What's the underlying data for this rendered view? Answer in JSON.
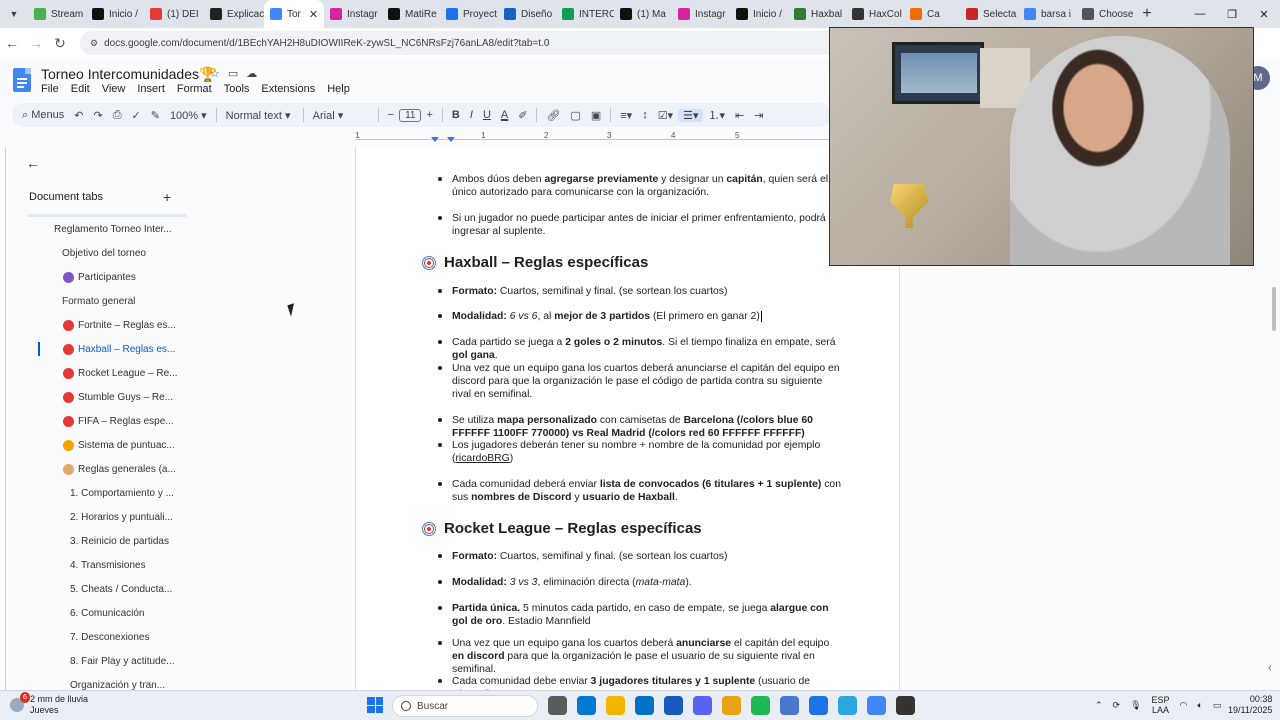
{
  "browser": {
    "tabs": [
      {
        "label": "Stream",
        "color": "#4caf50",
        "icon": "stream-icon"
      },
      {
        "label": "Inicio /",
        "color": "#111111",
        "icon": "x-icon"
      },
      {
        "label": "(1) DEI",
        "color": "#e53935",
        "icon": "youtube-icon"
      },
      {
        "label": "Explicac",
        "color": "#222222",
        "icon": "chatgpt-icon"
      },
      {
        "label": "Tor",
        "color": "#4285f4",
        "icon": "docs-icon",
        "active": true
      },
      {
        "label": "Instagr",
        "color": "#d6249f",
        "icon": "instagram-icon"
      },
      {
        "label": "MatiRe",
        "color": "#111111",
        "icon": "x-icon"
      },
      {
        "label": "Proyect",
        "color": "#1a73e8",
        "icon": "globe-icon"
      },
      {
        "label": "Diseño",
        "color": "#1565c0",
        "icon": "globe-icon"
      },
      {
        "label": "INTERC",
        "color": "#0f9d58",
        "icon": "sheets-icon"
      },
      {
        "label": "(1) Ma",
        "color": "#111111",
        "icon": "x-icon"
      },
      {
        "label": "Instagr",
        "color": "#d6249f",
        "icon": "instagram-icon"
      },
      {
        "label": "Inicio /",
        "color": "#111111",
        "icon": "x-icon"
      },
      {
        "label": "Haxbal",
        "color": "#2e7d32",
        "icon": "haxball-icon"
      },
      {
        "label": "HaxCol",
        "color": "#333333",
        "icon": "haxcol-icon"
      },
      {
        "label": "Ca",
        "color": "#ef6c00",
        "icon": "brave-icon"
      },
      {
        "label": "Selecta",
        "color": "#c62828",
        "icon": "selecta-icon"
      },
      {
        "label": "barsa i",
        "color": "#4285f4",
        "icon": "google-icon"
      },
      {
        "label": "Choose",
        "color": "#555555",
        "icon": "globe-icon"
      }
    ],
    "close_glyph": "✕",
    "new_tab_glyph": "+",
    "window_controls": [
      "—",
      "❐",
      "✕"
    ],
    "url": "docs.google.com/document/d/1BEchYAH2H8uDIOWIIReK-zywSL_NC6NRsFzj76anLA8/edit?tab=t.0"
  },
  "doc": {
    "title": "Torneo Intercomunidades🏆",
    "menu": [
      "File",
      "Edit",
      "View",
      "Insert",
      "Format",
      "Tools",
      "Extensions",
      "Help"
    ],
    "avatar_initial": "M"
  },
  "toolbar": {
    "search_label": "Menus",
    "zoom": "100%",
    "style": "Normal text",
    "font": "Arial",
    "font_size": "11"
  },
  "ruler": {
    "numbers": [
      "1",
      "1",
      "2",
      "3",
      "4",
      "5"
    ]
  },
  "sidebar": {
    "title": "Document tabs",
    "add_glyph": "+",
    "back_glyph": "←",
    "items": [
      {
        "label": "Reglamento Torneo Inter...",
        "indent": 0,
        "emoji": ""
      },
      {
        "label": "Objetivo del torneo",
        "indent": 1,
        "emoji": ""
      },
      {
        "label": "Participantes",
        "indent": 1,
        "emoji": "people"
      },
      {
        "label": "Formato general",
        "indent": 1,
        "emoji": ""
      },
      {
        "label": "Fortnite – Reglas es...",
        "indent": 1,
        "emoji": "target"
      },
      {
        "label": "Haxball – Reglas es...",
        "indent": 1,
        "emoji": "target",
        "active": true
      },
      {
        "label": "Rocket League – Re...",
        "indent": 1,
        "emoji": "target"
      },
      {
        "label": "Stumble Guys – Re...",
        "indent": 1,
        "emoji": "target"
      },
      {
        "label": "FIFA – Reglas espe...",
        "indent": 1,
        "emoji": "target"
      },
      {
        "label": "Sistema de puntuac...",
        "indent": 1,
        "emoji": "medal"
      },
      {
        "label": "Reglas generales (a...",
        "indent": 1,
        "emoji": "cake"
      },
      {
        "label": "1. Comportamiento y ...",
        "indent": 2,
        "emoji": ""
      },
      {
        "label": "2. Horarios y puntuali...",
        "indent": 2,
        "emoji": ""
      },
      {
        "label": "3. Reinicio de partidas",
        "indent": 2,
        "emoji": ""
      },
      {
        "label": "4. Transmisiones",
        "indent": 2,
        "emoji": ""
      },
      {
        "label": "5. Cheats / Conducta...",
        "indent": 2,
        "emoji": ""
      },
      {
        "label": "6. Comunicación",
        "indent": 2,
        "emoji": ""
      },
      {
        "label": "7. Desconexiones",
        "indent": 2,
        "emoji": ""
      },
      {
        "label": "8. Fair Play y actitude...",
        "indent": 2,
        "emoji": ""
      },
      {
        "label": "Organización y tran...",
        "indent": 2,
        "emoji": ""
      }
    ]
  },
  "content": {
    "b1": {
      "t1": "Ambos dúos deben ",
      "b1": "agregarse previamente",
      "t2": " y designar un ",
      "b2": "capitán",
      "t3": ", quien será el único autorizado para comunicarse con la organización."
    },
    "b2": {
      "t1": "Si un jugador no puede participar antes de iniciar el primer enfrentamiento, podrá ingresar al suplente."
    },
    "h_haxball": "Haxball – Reglas específicas",
    "hx1": {
      "b1": "Formato:",
      "t1": " Cuartos, semifinal y final. (se sortean los cuartos)"
    },
    "hx2": {
      "b1": "Modalidad:",
      "i1": " 6 vs 6",
      "t1": ", al ",
      "b2": "mejor de 3 partidos",
      "t2": " (El primero en ganar 2)"
    },
    "hx3": {
      "t1": "Cada partido se juega a ",
      "b1": "2 goles o 2 minutos",
      "t2": ". Si el tiempo finaliza en empate, será ",
      "b2": "gol gana",
      "t3": "."
    },
    "hx4": {
      "t1": "Una vez que un equipo gana los cuartos deberá anunciarse el capitán del equipo en discord para que la organización le pase el código de partida contra su siguiente rival en semifinal."
    },
    "hx5": {
      "t1": "Se utiliza ",
      "b1": "mapa personalizado",
      "t2": " con camisetas de ",
      "b2": "Barcelona (/colors blue 60 FFFFFF 1100FF 770000) vs Real Madrid (/colors red 60 FFFFFF FFFFFF)"
    },
    "hx6": {
      "t1": "Los jugadores deberán tener su nombre + nombre de la comunidad por ejemplo (",
      "u1": "ricardoBRG",
      "t2": ")"
    },
    "hx7": {
      "t1": "Cada comunidad deberá enviar ",
      "b1": "lista de convocados (6 titulares + 1 suplente)",
      "t2": " con sus ",
      "b2": "nombres de Discord",
      "t3": " y ",
      "b3": "usuario de Haxball",
      "t4": "."
    },
    "h_rocket": "Rocket League – Reglas específicas",
    "rl1": {
      "b1": "Formato:",
      "t1": " Cuartos, semifinal y final. (se sortean los cuartos)"
    },
    "rl2": {
      "b1": "Modalidad:",
      "i1": " 3 vs 3",
      "t1": ", eliminación directa (",
      "i2": "mata-mata",
      "t2": ")."
    },
    "rl3": {
      "b1": "Partida única.",
      "t1": " 5 minutos cada partido, en caso de empate, se juega ",
      "b2": "alargue con gol de oro",
      "t2": ". Estadio Mannfield"
    },
    "rl4": {
      "t1": "Una vez que un equipo gana los cuartos deberá ",
      "b1": "anunciarse",
      "t2": " el capitán del equipo ",
      "b2": "en discord",
      "t3": " para que la organización le pase el usuario de su siguiente rival en semifinal."
    },
    "rl5": {
      "t1": "Cada comunidad debe enviar ",
      "b1": "3 jugadores titulares y 1 suplente",
      "t2": " (usuario de Discord)."
    }
  },
  "taskbar": {
    "weather_line1": "2 mm de lluvia",
    "weather_line2": "Jueves",
    "weather_badge": "6",
    "search_placeholder": "Buscar",
    "lang_line1": "ESP",
    "lang_line2": "LAA",
    "time": "00:38",
    "date": "19/11/2025",
    "app_colors": [
      "#5b5b5b",
      "#0078d4",
      "#f2b705",
      "#0072c6",
      "#185abd",
      "#5865f2",
      "#e8a317",
      "#1db954",
      "#4a78d0",
      "#1a73e8",
      "#2ca5e0",
      "#4285f4",
      "#333333"
    ]
  }
}
